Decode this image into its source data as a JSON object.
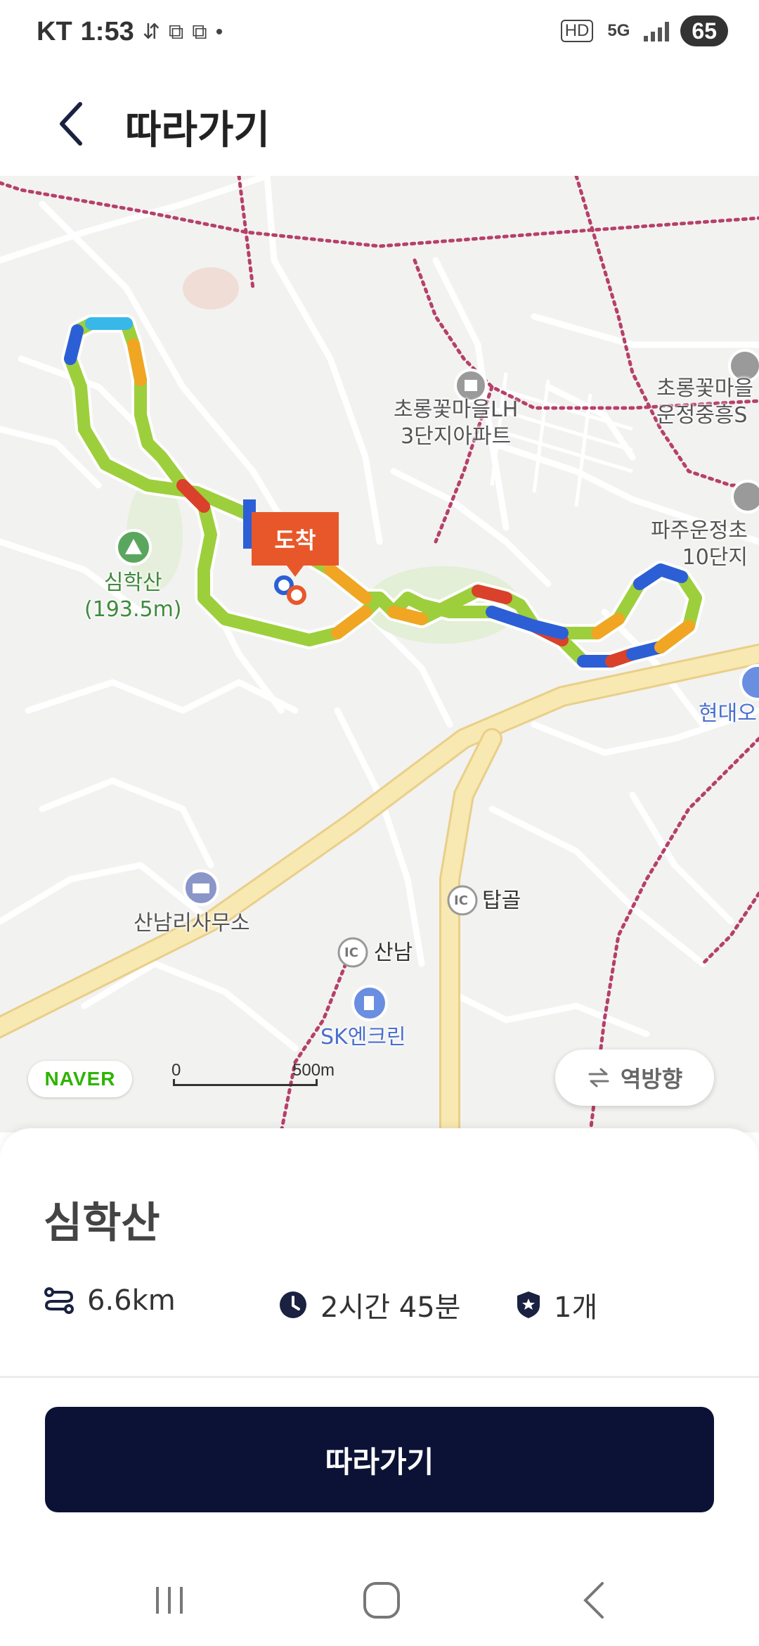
{
  "status_bar": {
    "carrier": "KT",
    "time": "1:53",
    "hd": "HD",
    "network": "5G",
    "battery": "65"
  },
  "header": {
    "title": "따라가기",
    "back_icon": "chevron-left-icon"
  },
  "map": {
    "labels": {
      "lh_apt": "초롱꽃마을LH\n3단지아파트",
      "chorong_right": "초롱꽃마을\n운정중흥S",
      "paju_apt": "파주운정초\n10단지",
      "mountain": "심학산\n(193.5m)",
      "sannam_office": "산남리사무소",
      "tapgol": "탑골",
      "sannam": "산남",
      "ic": "IC",
      "sk": "SK엔크린",
      "hyundai": "현대오"
    },
    "arrive_label": "도착",
    "naver": "NAVER",
    "scale_zero": "0",
    "scale_dist": "500m",
    "reverse_label": "역방향",
    "colors": {
      "route_green": "#9dcf3c",
      "route_blue": "#2c5fd6",
      "route_orange": "#f0a623",
      "route_red": "#d9412b",
      "road_major": "#f7e4a8",
      "trail": "#b6406a"
    }
  },
  "course": {
    "name": "심학산",
    "distance": "6.6km",
    "duration": "2시간 45분",
    "badges": "1개",
    "icons": [
      "route-icon",
      "clock-icon",
      "shield-star-icon"
    ]
  },
  "follow_button": "따라가기",
  "nav_bar": [
    "recent-apps-icon",
    "home-icon",
    "back-icon"
  ]
}
